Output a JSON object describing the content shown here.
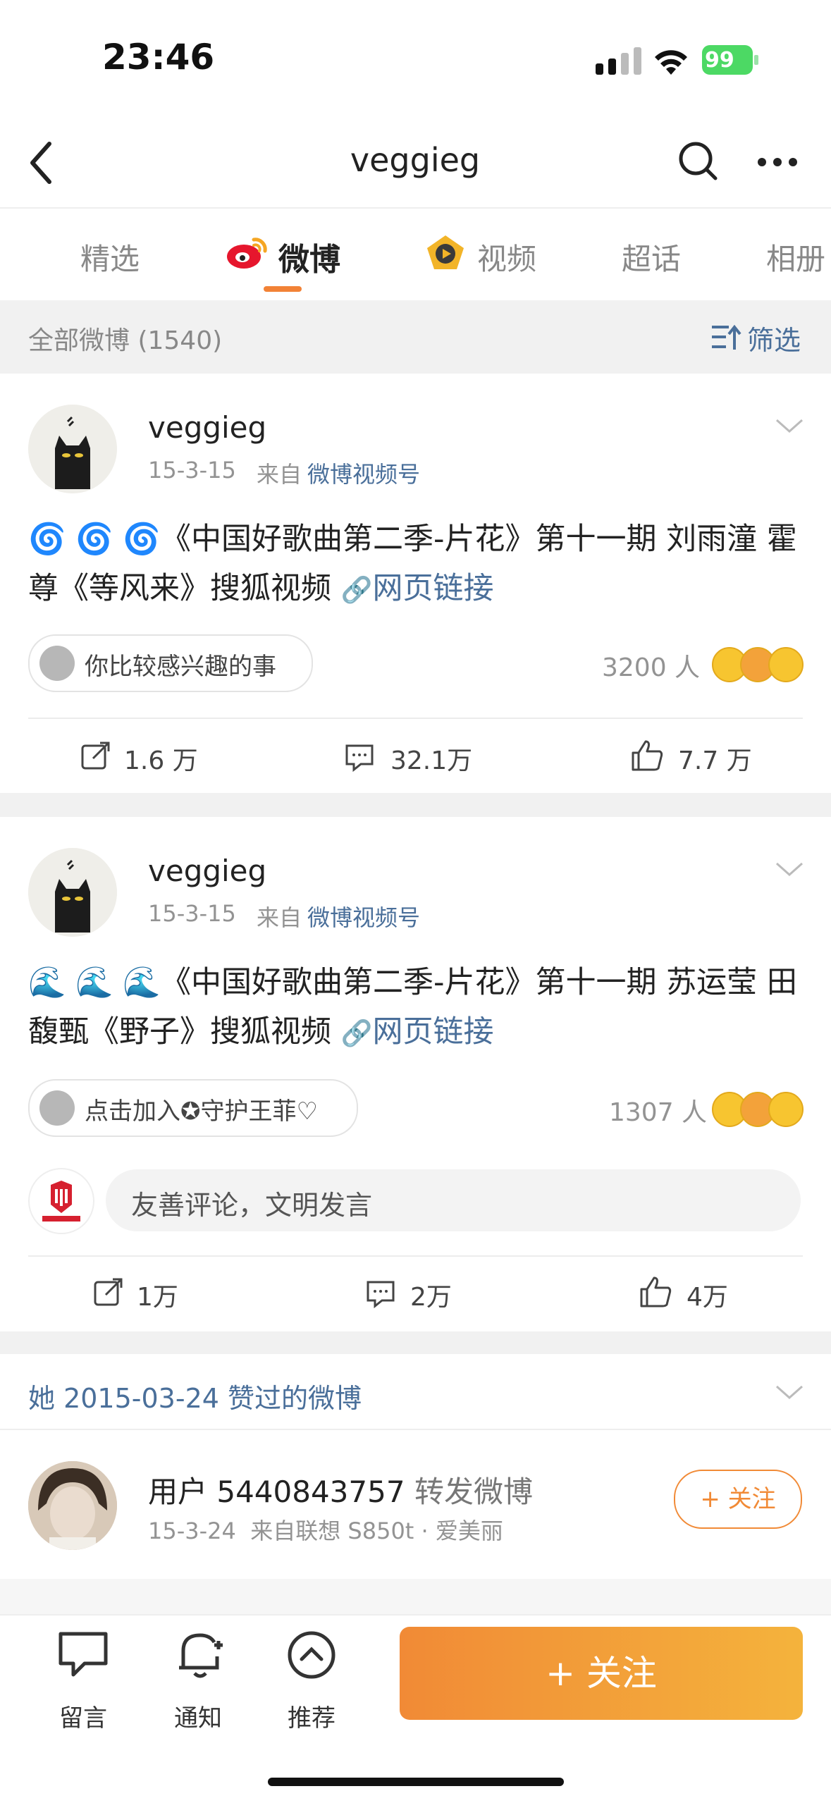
{
  "status_bar": {
    "time": "23:46",
    "battery": "99"
  },
  "nav": {
    "title": "veggieg"
  },
  "tabs": [
    {
      "label": "精选"
    },
    {
      "label": "微博"
    },
    {
      "label": "视频"
    },
    {
      "label": "超话"
    },
    {
      "label": "相册"
    }
  ],
  "filter_bar": {
    "all_posts": "全部微博 (1540)",
    "filter": "筛选"
  },
  "posts": [
    {
      "user": "veggieg",
      "date": "15-3-15",
      "source_prefix": "来自",
      "source": "微博视频号",
      "body_emoji": "🌀 🌀 🌀",
      "body_text": "《中国好歌曲第二季-片花》第十一期 刘雨潼 霍尊《等风来》搜狐视频",
      "link": "网页链接",
      "tag": "你比较感兴趣的事",
      "people": "3200 人",
      "repost": "1.6 万",
      "comment": "32.1万",
      "like": "7.7 万"
    },
    {
      "user": "veggieg",
      "date": "15-3-15",
      "source_prefix": "来自",
      "source": "微博视频号",
      "body_emoji": "🌊 🌊 🌊",
      "body_text": "《中国好歌曲第二季-片花》第十一期 苏运莹 田馥甄《野子》搜狐视频",
      "link": "网页链接",
      "tag": "点击加入✪守护王菲♡",
      "people": "1307 人",
      "comment_placeholder": "友善评论，文明发言",
      "repost": "1万",
      "comment": "2万",
      "like": "4万"
    }
  ],
  "liked_section": {
    "title": "她 2015-03-24 赞过的微博"
  },
  "liked_post": {
    "user": "用户 5440843757",
    "action": "转发微博",
    "meta": "15-3-24  来自联想 S850t · 爱美丽",
    "follow": "+ 关注"
  },
  "bottom_bar": {
    "message": "留言",
    "notify": "通知",
    "recommend": "推荐",
    "follow": "+ 关注"
  },
  "colors": {
    "accent": "#f18a36",
    "link": "#4a6f9a",
    "gray": "#939393"
  }
}
